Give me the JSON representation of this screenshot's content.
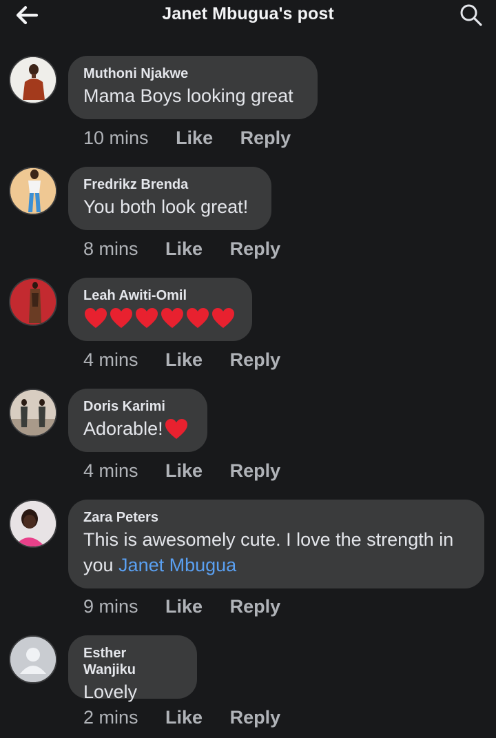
{
  "header": {
    "title": "Janet Mbugua's post",
    "back_icon": "arrow-left-icon",
    "search_icon": "search-icon"
  },
  "actions": {
    "like_label": "Like",
    "reply_label": "Reply"
  },
  "colors": {
    "background": "#18191b",
    "bubble": "#3a3b3c",
    "text": "#e4e6eb",
    "secondary_text": "#b0b3b8",
    "mention": "#5aa0f2",
    "heart": "#e8212f"
  },
  "comments": [
    {
      "author": "Muthoni Njakwe",
      "text": "Mama Boys looking great",
      "time": "10 mins"
    },
    {
      "author": "Fredrikz Brenda",
      "text": "You both look great!",
      "time": "8 mins"
    },
    {
      "author": "Leah Awiti-Omil",
      "text": "",
      "hearts": 6,
      "time": "4 mins"
    },
    {
      "author": "Doris Karimi",
      "text": "Adorable!",
      "hearts": 1,
      "time": "4 mins"
    },
    {
      "author": "Zara Peters",
      "text_line1": "This is awesomely cute. I love the strength in",
      "text_line2_prefix": "you ",
      "mention": "Janet Mbugua",
      "time": "9 mins"
    },
    {
      "author": "Esther Wanjiku",
      "text": "Lovely",
      "time": "2 mins"
    }
  ]
}
